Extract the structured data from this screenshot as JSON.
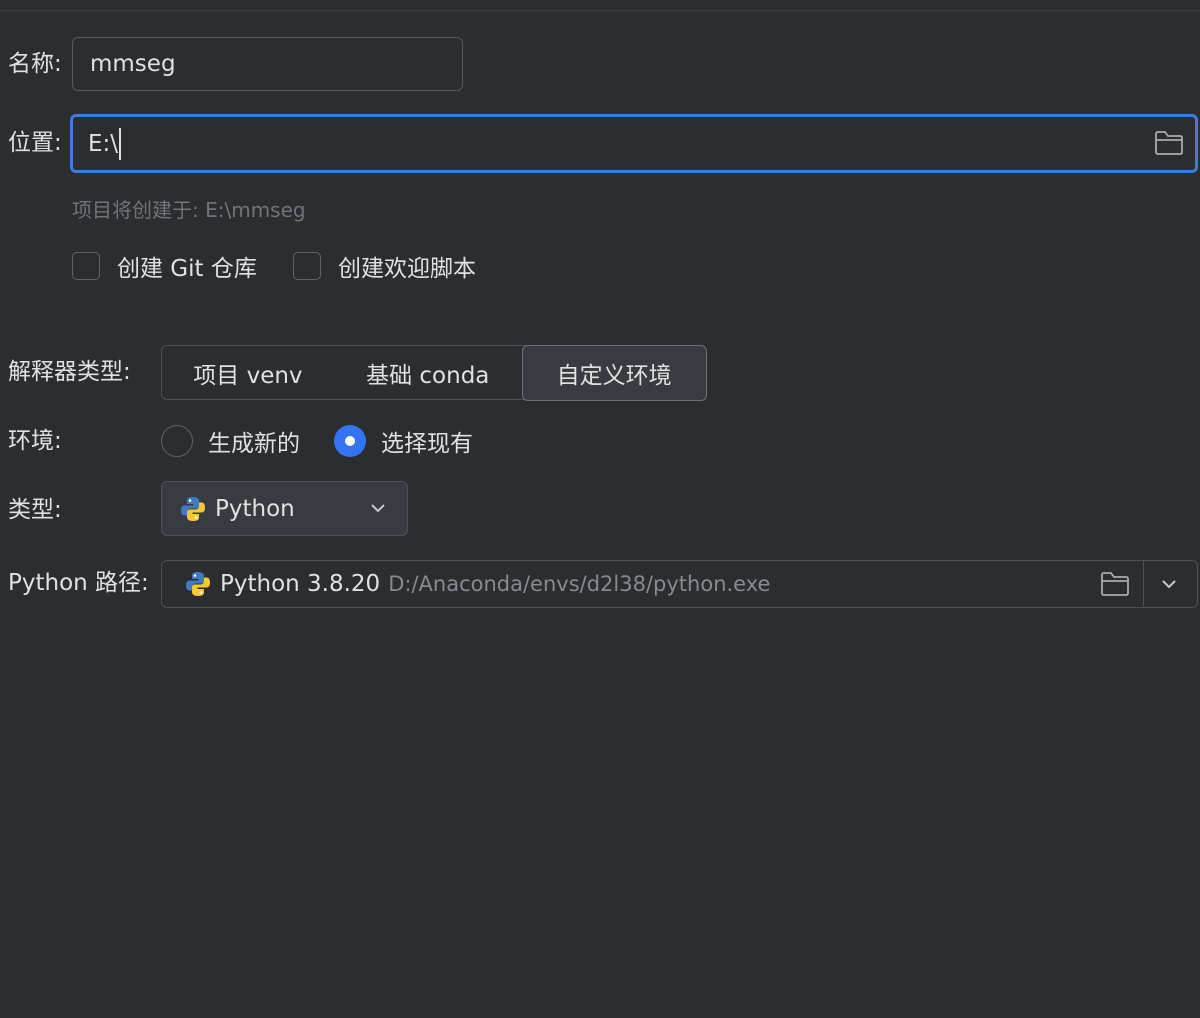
{
  "name": {
    "label": "名称:",
    "value": "mmseg"
  },
  "location": {
    "label": "位置:",
    "value": "E:\\",
    "icon": "folder-icon"
  },
  "hint": "项目将创建于: E:\\mmseg",
  "checkboxes": [
    {
      "label": "创建 Git 仓库",
      "checked": false
    },
    {
      "label": "创建欢迎脚本",
      "checked": false
    }
  ],
  "interpreter": {
    "label": "解释器类型:",
    "options": [
      "项目 venv",
      "基础 conda",
      "自定义环境"
    ],
    "selected": "自定义环境"
  },
  "environment": {
    "label": "环境:",
    "options": [
      "生成新的",
      "选择现有"
    ],
    "selected": "选择现有"
  },
  "type": {
    "label": "类型:",
    "value": "Python",
    "icon": "python-icon"
  },
  "python_path": {
    "label": "Python 路径:",
    "version": "Python 3.8.20",
    "path": "D:/Anaconda/envs/d2l38/python.exe",
    "icons": [
      "python-icon",
      "folder-icon",
      "chevron-down-icon"
    ]
  },
  "colors": {
    "background": "#2b2d30",
    "accent": "#3574f0",
    "focus_border": "#3d7be0",
    "text": "#dfe1e5",
    "muted": "#6f737a"
  }
}
